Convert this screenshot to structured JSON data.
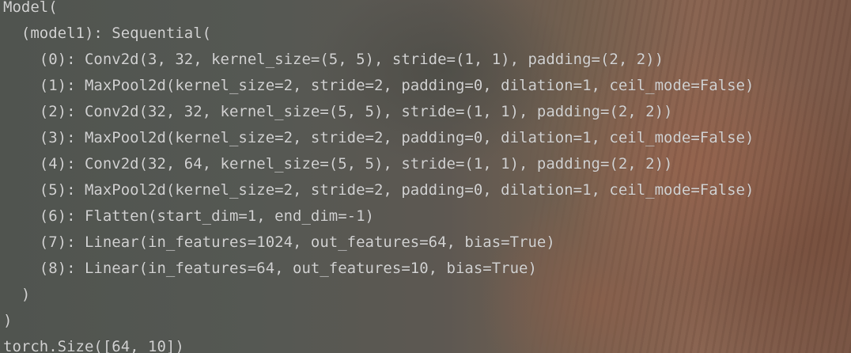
{
  "console": {
    "lines": [
      "Model(",
      "  (model1): Sequential(",
      "    (0): Conv2d(3, 32, kernel_size=(5, 5), stride=(1, 1), padding=(2, 2))",
      "    (1): MaxPool2d(kernel_size=2, stride=2, padding=0, dilation=1, ceil_mode=False)",
      "    (2): Conv2d(32, 32, kernel_size=(5, 5), stride=(1, 1), padding=(2, 2))",
      "    (3): MaxPool2d(kernel_size=2, stride=2, padding=0, dilation=1, ceil_mode=False)",
      "    (4): Conv2d(32, 64, kernel_size=(5, 5), stride=(1, 1), padding=(2, 2))",
      "    (5): MaxPool2d(kernel_size=2, stride=2, padding=0, dilation=1, ceil_mode=False)",
      "    (6): Flatten(start_dim=1, end_dim=-1)",
      "    (7): Linear(in_features=1024, out_features=64, bias=True)",
      "    (8): Linear(in_features=64, out_features=10, bias=True)",
      "  )",
      ")",
      "torch.Size([64, 10])"
    ]
  },
  "colors": {
    "text": "#d2d2d2"
  }
}
